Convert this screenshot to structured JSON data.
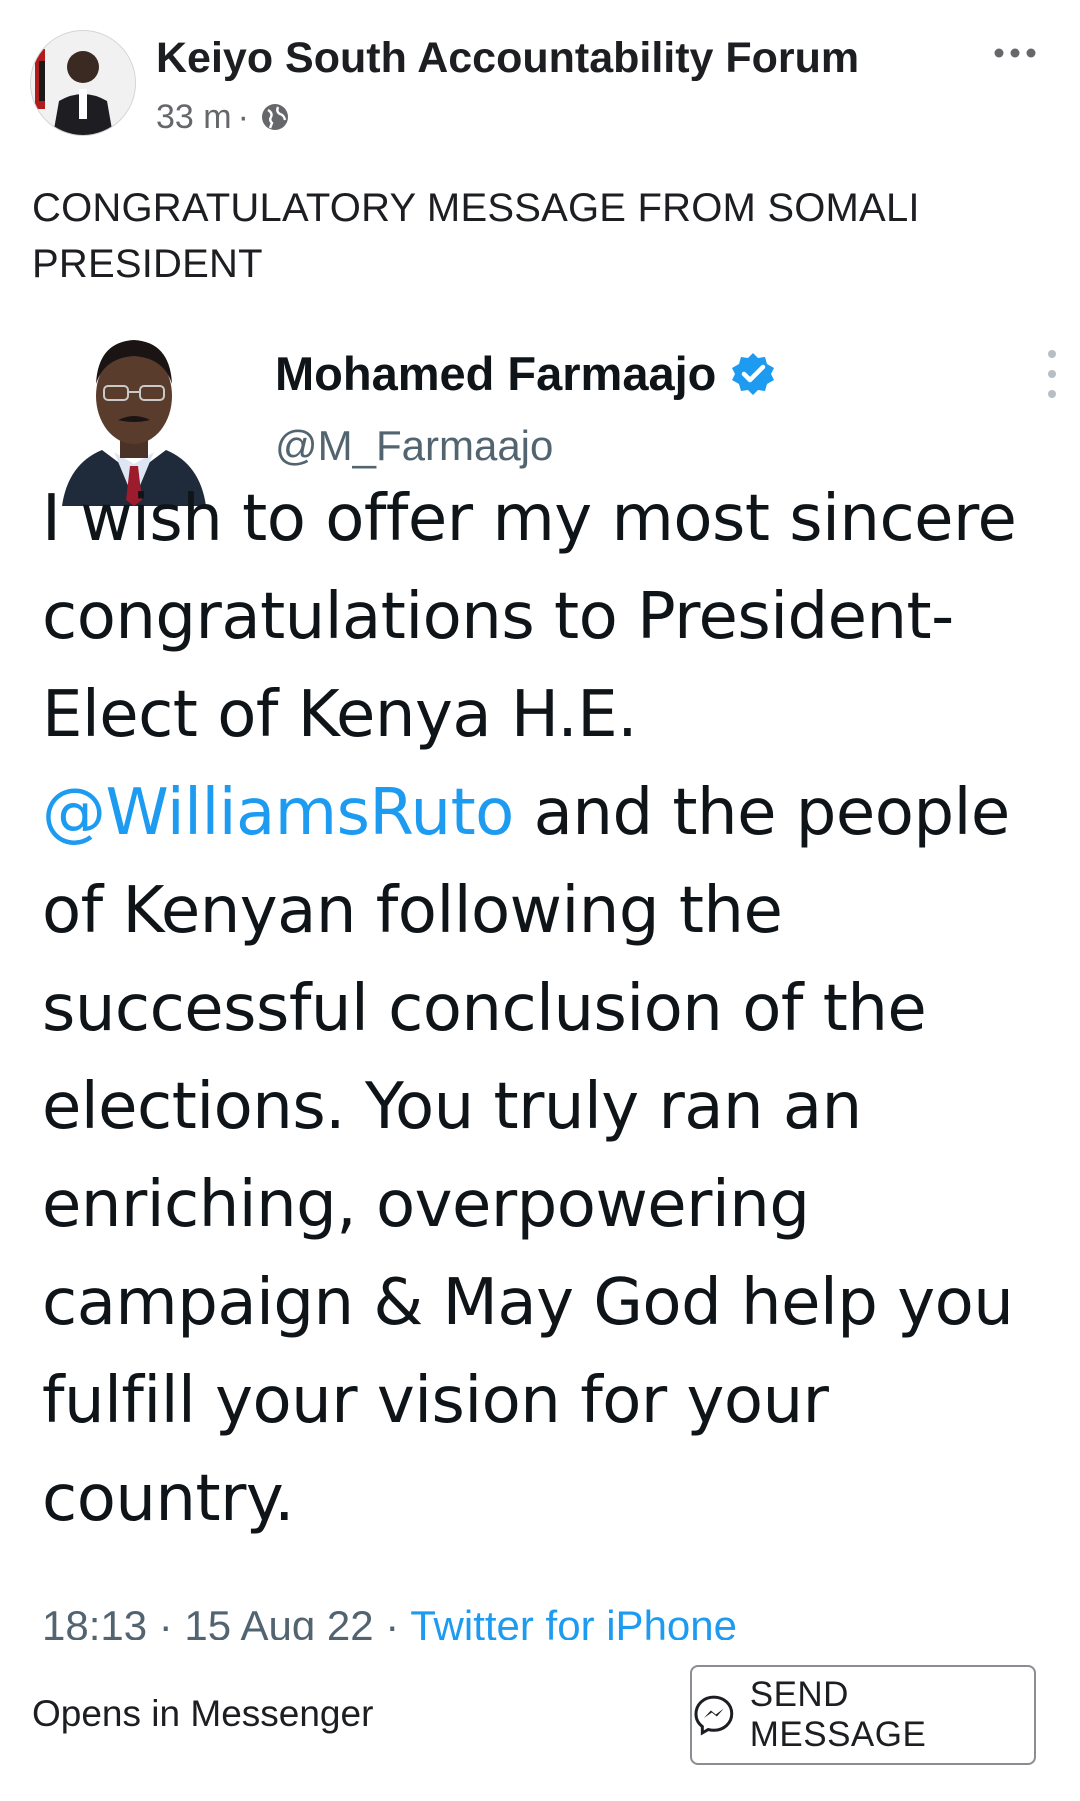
{
  "post": {
    "page_name": "Keiyo South Accountability Forum",
    "time": "33 m",
    "separator": "·",
    "visibility_icon": "globe-icon",
    "more_icon": "more-horizontal-icon",
    "text": "CONGRATULATORY MESSAGE FROM SOMALI PRESIDENT"
  },
  "tweet": {
    "author_name": "Mohamed Farmaajo",
    "verified_icon": "verified-badge-icon",
    "handle": "@M_Farmaajo",
    "more_icon": "more-vertical-icon",
    "body_before": "I wish to offer my most sincere congratulations to President-Elect of Kenya H.E. ",
    "mention": "@WilliamsRuto",
    "body_after": " and the people of Kenyan following the successful conclusion of the elections. You truly ran an enriching, overpowering campaign & May God help you fulfill your vision for your country.",
    "timestamp": "18:13 · 15 Aug 22 · ",
    "client": "Twitter for iPhone"
  },
  "cta": {
    "caption": "Opens in Messenger",
    "button_label": "SEND MESSAGE",
    "button_icon": "messenger-icon"
  },
  "colors": {
    "mention": "#1d9bf0",
    "verified": "#1d9bf0",
    "secondary_text": "#65676b"
  }
}
